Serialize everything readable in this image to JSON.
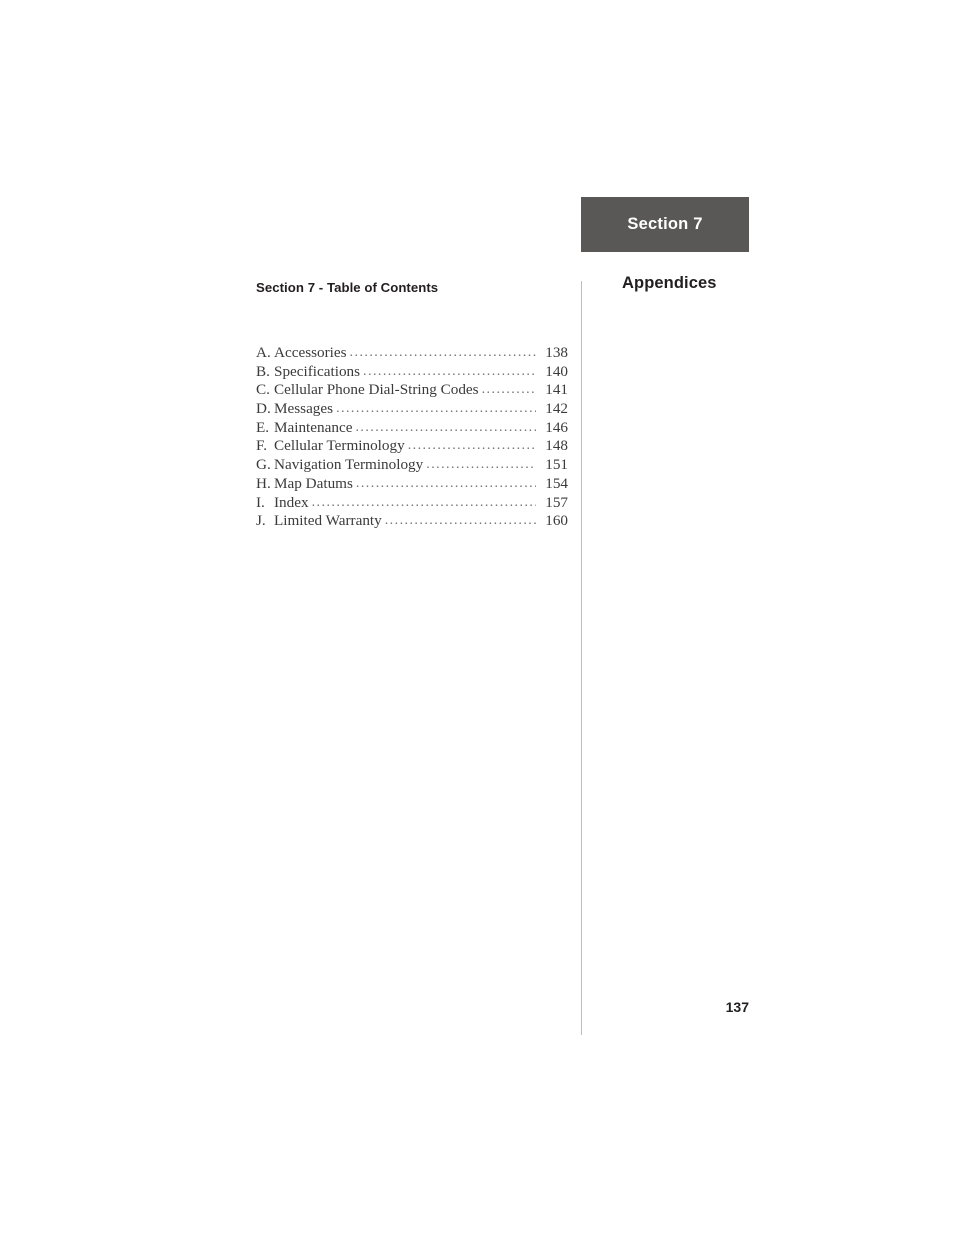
{
  "document": {
    "page_number": "137"
  },
  "section_tab": {
    "label": "Section 7"
  },
  "right_column": {
    "heading": "Appendices"
  },
  "left_column": {
    "toc_heading": "Section 7 - Table of Contents",
    "entries": [
      {
        "letter": "A.",
        "title": "Accessories",
        "page": "138"
      },
      {
        "letter": "B.",
        "title": "Specifications",
        "page": "140"
      },
      {
        "letter": "C.",
        "title": "Cellular Phone Dial-String Codes",
        "page": "141"
      },
      {
        "letter": "D.",
        "title": "Messages",
        "page": "142"
      },
      {
        "letter": "E.",
        "title": "Maintenance",
        "page": "146"
      },
      {
        "letter": "F.",
        "title": "Cellular Terminology",
        "page": "148"
      },
      {
        "letter": "G.",
        "title": "Navigation Terminology",
        "page": "151"
      },
      {
        "letter": "H.",
        "title": "Map Datums",
        "page": "154"
      },
      {
        "letter": "I.",
        "title": "Index",
        "page": "157"
      },
      {
        "letter": "J.",
        "title": "Limited Warranty",
        "page": "160"
      }
    ]
  },
  "colors": {
    "tab_background": "#595857",
    "tab_text": "#ffffff",
    "heading_text": "#231f20",
    "body_text": "#3b3b3b",
    "divider": "#bcbec0",
    "page_background": "#ffffff"
  }
}
